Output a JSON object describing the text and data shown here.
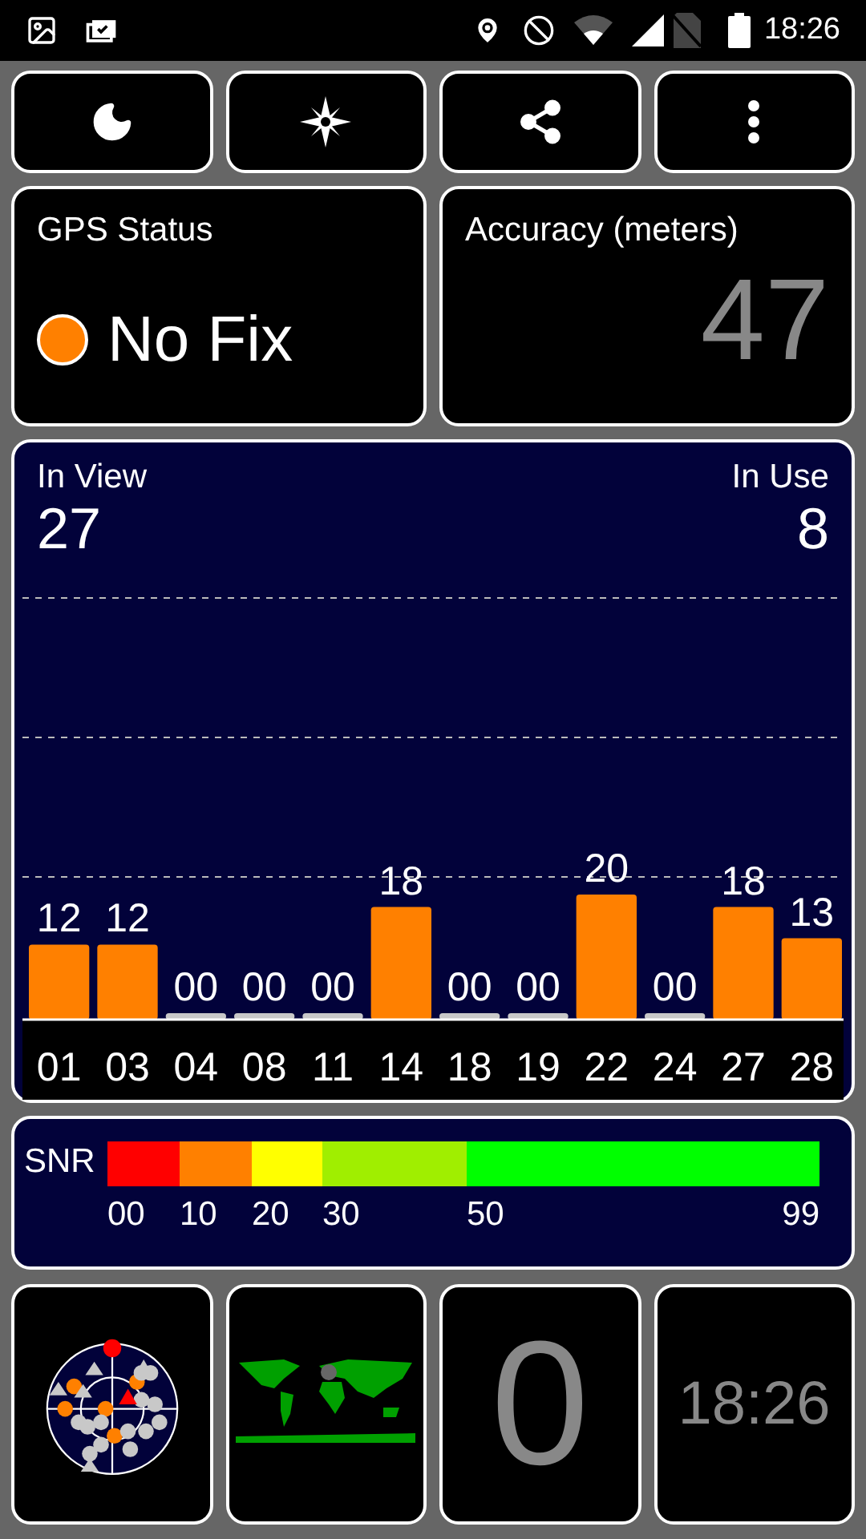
{
  "status_bar": {
    "time": "18:26"
  },
  "gps_status": {
    "title": "GPS Status",
    "status": "No Fix",
    "color": "#ff8000"
  },
  "accuracy": {
    "title": "Accuracy (meters)",
    "value": "47"
  },
  "satellites": {
    "in_view_label": "In View",
    "in_view": "27",
    "in_use_label": "In Use",
    "in_use": "8",
    "chart_data": {
      "type": "bar",
      "categories": [
        "01",
        "03",
        "04",
        "08",
        "11",
        "14",
        "18",
        "19",
        "22",
        "24",
        "27",
        "28"
      ],
      "values": [
        12,
        12,
        0,
        0,
        0,
        18,
        0,
        0,
        20,
        0,
        18,
        13
      ],
      "value_labels": [
        "12",
        "12",
        "00",
        "00",
        "00",
        "18",
        "00",
        "00",
        "20",
        "00",
        "18",
        "13"
      ]
    }
  },
  "snr": {
    "label": "SNR",
    "segments": [
      {
        "color": "#ff0000"
      },
      {
        "color": "#ff8000"
      },
      {
        "color": "#ffff00"
      },
      {
        "color": "#a0ee00"
      },
      {
        "color": "#00ff00"
      }
    ],
    "ticks": [
      "00",
      "10",
      "20",
      "30",
      "50",
      "99"
    ]
  },
  "tiles": {
    "count": "0",
    "clock": "18:26"
  }
}
